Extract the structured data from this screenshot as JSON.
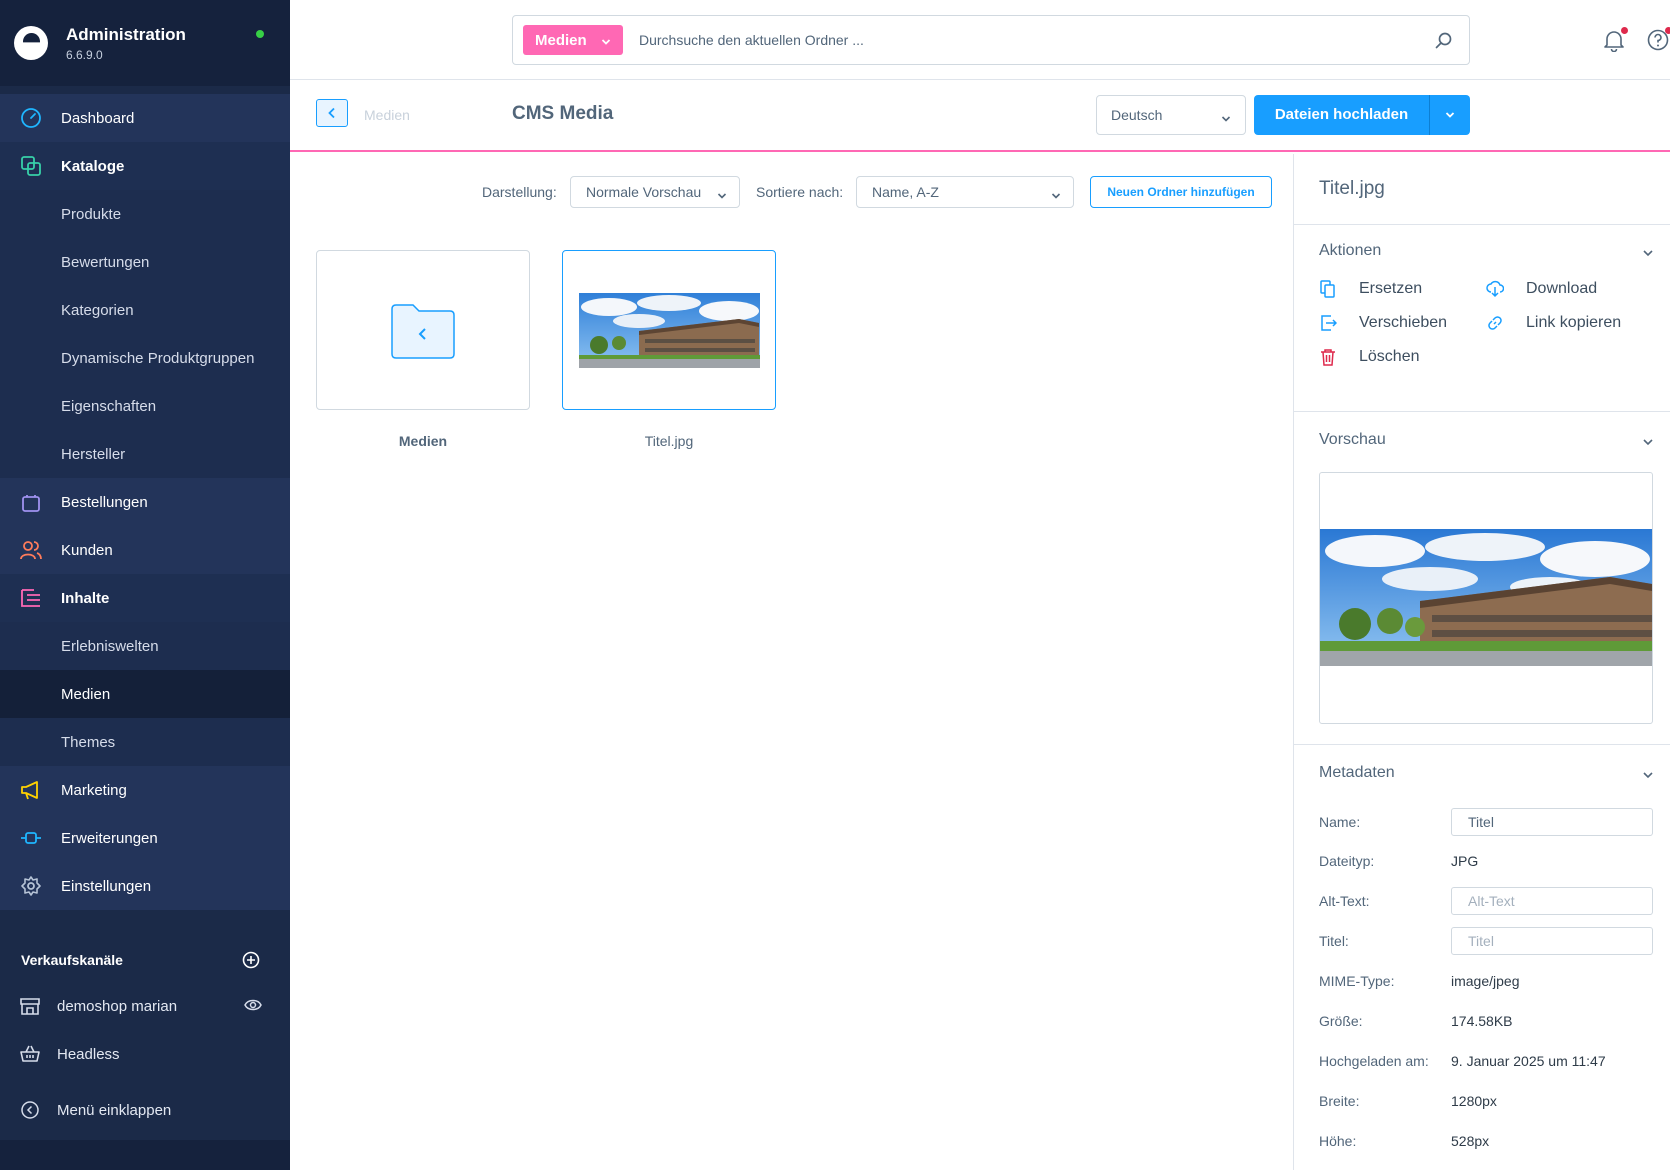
{
  "app": {
    "title": "Administration",
    "version": "6.6.9.0"
  },
  "nav": {
    "dashboard": "Dashboard",
    "kataloge": "Kataloge",
    "kataloge_items": [
      "Produkte",
      "Bewertungen",
      "Kategorien",
      "Dynamische Produktgruppen",
      "Eigenschaften",
      "Hersteller"
    ],
    "bestellungen": "Bestellungen",
    "kunden": "Kunden",
    "inhalte": "Inhalte",
    "inhalte_items": [
      "Erlebniswelten",
      "Medien",
      "Themes"
    ],
    "marketing": "Marketing",
    "erweiterungen": "Erweiterungen",
    "einstellungen": "Einstellungen"
  },
  "sales_channels": {
    "title": "Verkaufskanäle",
    "items": [
      "demoshop marian",
      "Headless"
    ]
  },
  "collapse_label": "Menü einklappen",
  "search": {
    "type": "Medien",
    "placeholder": "Durchsuche den aktuellen Ordner ..."
  },
  "smartbar": {
    "breadcrumb": "Medien",
    "title": "CMS Media",
    "language": "Deutsch",
    "upload_label": "Dateien hochladen"
  },
  "toolbar": {
    "display_label": "Darstellung:",
    "display_value": "Normale Vorschau",
    "sort_label": "Sortiere nach:",
    "sort_value": "Name, A-Z",
    "new_folder": "Neuen Ordner hinzufügen"
  },
  "grid": {
    "folder_name": "Medien",
    "file_name": "Titel.jpg"
  },
  "panel": {
    "title": "Titel.jpg",
    "actions_title": "Aktionen",
    "actions": {
      "replace": "Ersetzen",
      "download": "Download",
      "move": "Verschieben",
      "copy_link": "Link kopieren",
      "delete": "Löschen"
    },
    "preview_title": "Vorschau",
    "metadata_title": "Metadaten",
    "meta": {
      "name_label": "Name:",
      "name_value": "Titel",
      "filetype_label": "Dateityp:",
      "filetype_value": "JPG",
      "alt_label": "Alt-Text:",
      "alt_placeholder": "Alt-Text",
      "title_label": "Titel:",
      "title_placeholder": "Titel",
      "mime_label": "MIME-Type:",
      "mime_value": "image/jpeg",
      "size_label": "Größe:",
      "size_value": "174.58KB",
      "uploaded_label": "Hochgeladen am:",
      "uploaded_value": "9. Januar 2025 um 11:47",
      "width_label": "Breite:",
      "width_value": "1280px",
      "height_label": "Höhe:",
      "height_value": "528px"
    }
  },
  "colors": {
    "accent": "#189eff",
    "pink": "#ff68b4",
    "sidebar": "#1b2a48",
    "danger": "#de294c"
  }
}
